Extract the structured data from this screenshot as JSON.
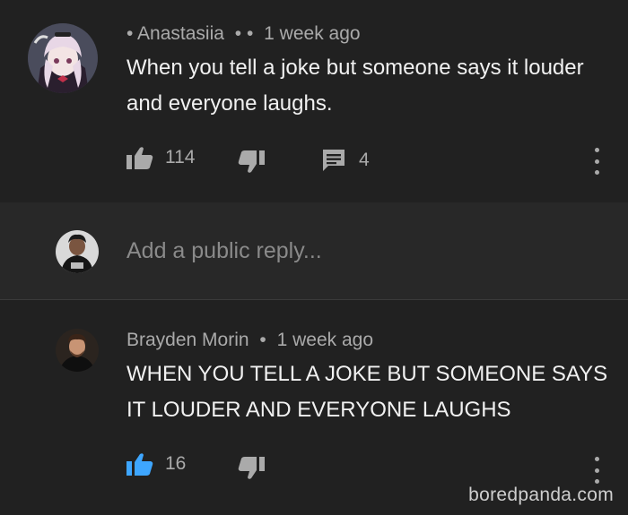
{
  "comments": [
    {
      "author": "Anastasiia",
      "author_prefix": "•",
      "author_suffix": "• •",
      "time": "1 week ago",
      "text": "When you tell a joke but someone says it louder and everyone laughs.",
      "likes": "114",
      "replies": "4",
      "liked": false
    },
    {
      "author": "Brayden Morin",
      "separator": "•",
      "time": "1 week ago",
      "text": "WHEN YOU TELL A JOKE BUT SOMEONE SAYS IT LOUDER AND EVERYONE LAUGHS",
      "likes": "16",
      "liked": true
    }
  ],
  "reply": {
    "placeholder": "Add a public reply..."
  },
  "watermark": "boredpanda.com",
  "icons": {
    "like": "thumbs-up-icon",
    "dislike": "thumbs-down-icon",
    "reply": "comment-icon",
    "more": "more-vert-icon"
  },
  "colors": {
    "background": "#212121",
    "reply_background": "#282828",
    "text_primary": "#f1f1f1",
    "text_secondary": "#aaaaaa",
    "liked_blue": "#3ea6ff"
  }
}
